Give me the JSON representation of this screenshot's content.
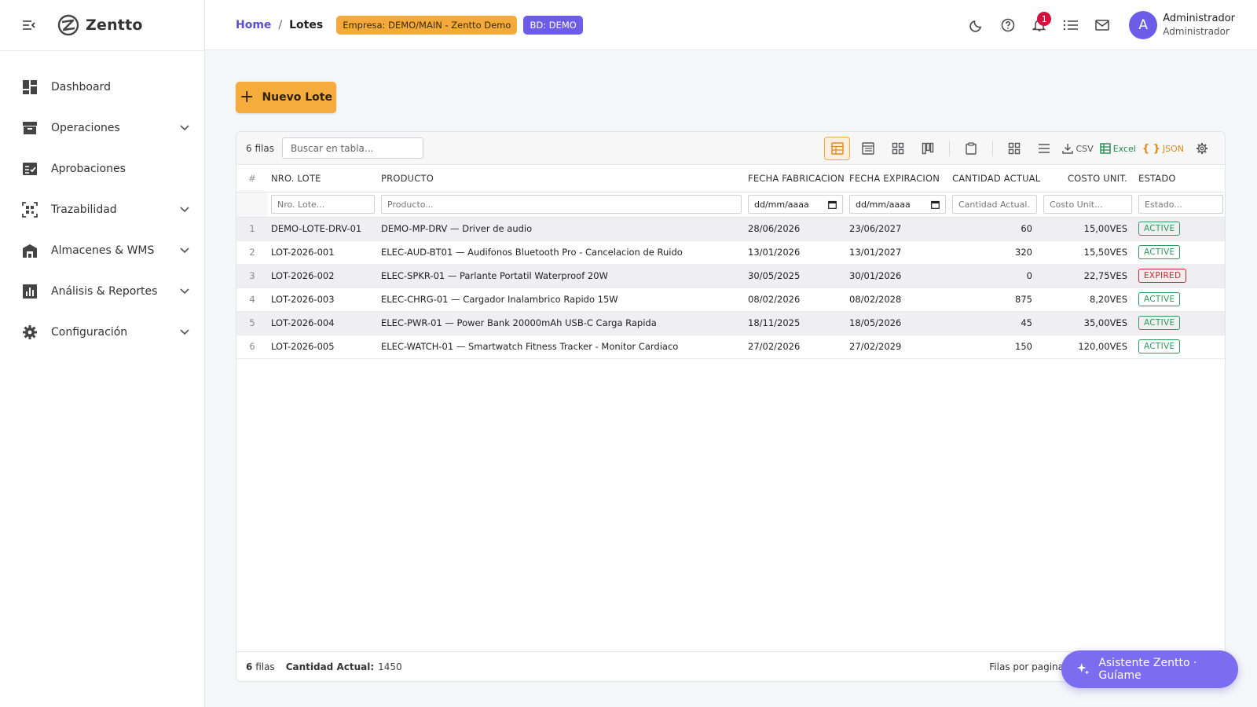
{
  "brand": {
    "name": "Zentto"
  },
  "sidebar": {
    "items": [
      {
        "label": "Dashboard",
        "icon": "dashboard-icon",
        "expandable": false
      },
      {
        "label": "Operaciones",
        "icon": "archive-icon",
        "expandable": true
      },
      {
        "label": "Aprobaciones",
        "icon": "approval-icon",
        "expandable": false
      },
      {
        "label": "Trazabilidad",
        "icon": "qr-scan-icon",
        "expandable": true
      },
      {
        "label": "Almacenes & WMS",
        "icon": "warehouse-icon",
        "expandable": true
      },
      {
        "label": "Análisis & Reportes",
        "icon": "bar-chart-icon",
        "expandable": true
      },
      {
        "label": "Configuración",
        "icon": "gear-icon",
        "expandable": true
      }
    ]
  },
  "breadcrumb": {
    "home": "Home",
    "separator": "/",
    "current": "Lotes"
  },
  "chips": {
    "empresa": "Empresa: DEMO/MAIN - Zentto Demo",
    "bd": "BD: DEMO"
  },
  "notifications": {
    "count": "1"
  },
  "user": {
    "initial": "A",
    "name": "Administrador",
    "role": "Administrador"
  },
  "actions": {
    "new_label": "Nuevo Lote"
  },
  "grid": {
    "row_count": "6 filas",
    "search_placeholder": "Buscar en tabla...",
    "export": {
      "csv": "CSV",
      "excel": "Excel",
      "json": "JSON"
    },
    "columns": {
      "num": "#",
      "lote": "NRO. LOTE",
      "producto": "PRODUCTO",
      "fab": "FECHA FABRICACION",
      "exp": "FECHA EXPIRACION",
      "cantidad": "CANTIDAD ACTUAL",
      "costo": "COSTO UNIT.",
      "estado": "ESTADO"
    },
    "filters": {
      "lote": "Nro. Lote...",
      "producto": "Producto...",
      "fab": "dd/mm/aaaa",
      "exp": "dd/mm/aaaa",
      "cantidad": "Cantidad Actual...",
      "costo": "Costo Unit...",
      "estado": "Estado..."
    },
    "rows": [
      {
        "num": "1",
        "lote": "DEMO-LOTE-DRV-01",
        "producto": "DEMO-MP-DRV — Driver de audio",
        "fab": "28/06/2026",
        "exp": "23/06/2027",
        "cantidad": "60",
        "costo": "15,00VES",
        "estado": "ACTIVE"
      },
      {
        "num": "2",
        "lote": "LOT-2026-001",
        "producto": "ELEC-AUD-BT01 — Audifonos Bluetooth Pro - Cancelacion de Ruido",
        "fab": "13/01/2026",
        "exp": "13/01/2027",
        "cantidad": "320",
        "costo": "15,50VES",
        "estado": "ACTIVE"
      },
      {
        "num": "3",
        "lote": "LOT-2026-002",
        "producto": "ELEC-SPKR-01 — Parlante Portatil Waterproof 20W",
        "fab": "30/05/2025",
        "exp": "30/01/2026",
        "cantidad": "0",
        "costo": "22,75VES",
        "estado": "EXPIRED"
      },
      {
        "num": "4",
        "lote": "LOT-2026-003",
        "producto": "ELEC-CHRG-01 — Cargador Inalambrico Rapido 15W",
        "fab": "08/02/2026",
        "exp": "08/02/2028",
        "cantidad": "875",
        "costo": "8,20VES",
        "estado": "ACTIVE"
      },
      {
        "num": "5",
        "lote": "LOT-2026-004",
        "producto": "ELEC-PWR-01 — Power Bank 20000mAh USB-C Carga Rapida",
        "fab": "18/11/2025",
        "exp": "18/05/2026",
        "cantidad": "45",
        "costo": "35,00VES",
        "estado": "ACTIVE"
      },
      {
        "num": "6",
        "lote": "LOT-2026-005",
        "producto": "ELEC-WATCH-01 — Smartwatch Fitness Tracker - Monitor Cardiaco",
        "fab": "27/02/2026",
        "exp": "27/02/2029",
        "cantidad": "150",
        "costo": "120,00VES",
        "estado": "ACTIVE"
      }
    ],
    "footer": {
      "count_num": "6",
      "count_word": "filas",
      "sum_label": "Cantidad Actual:",
      "sum_value": "1450",
      "per_page": "Filas por pagina"
    }
  },
  "assistant": {
    "label": "Asistente Zentto · Guíame"
  },
  "colors": {
    "accent": "#6c5ce7",
    "primary_button": "#f6ac3d",
    "status_active": "#2e9a5b",
    "status_expired": "#cf2a2a",
    "badge": "#d1123c"
  }
}
